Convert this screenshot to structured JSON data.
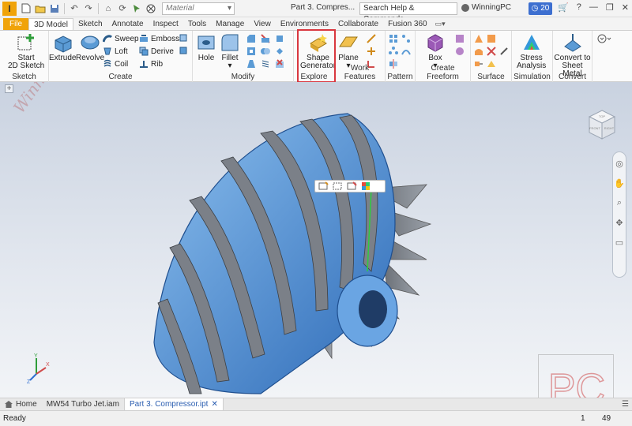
{
  "app": {
    "logo": "I"
  },
  "title_bar": {
    "material_placeholder": "Material",
    "document_title": "Part 3. Compres...",
    "help_search": "Search Help & Commands...",
    "user_name": "WinningPC",
    "clock_badge": "20"
  },
  "tabs": [
    "File",
    "3D Model",
    "Sketch",
    "Annotate",
    "Inspect",
    "Tools",
    "Manage",
    "View",
    "Environments",
    "Collaborate",
    "Fusion 360"
  ],
  "ribbon": {
    "sketch_panel": {
      "title": "Sketch",
      "start_label_1": "Start",
      "start_label_2": "2D Sketch"
    },
    "create_panel": {
      "title": "Create",
      "extrude": "Extrude",
      "revolve": "Revolve",
      "sweep": "Sweep",
      "loft": "Loft",
      "coil": "Coil",
      "emboss": "Emboss",
      "derive": "Derive",
      "rib": "Rib"
    },
    "modify_panel": {
      "title": "Modify",
      "hole": "Hole",
      "fillet": "Fillet"
    },
    "explore_panel": {
      "title": "Explore",
      "shape_1": "Shape",
      "shape_2": "Generator"
    },
    "work_features_panel": {
      "title": "Work Features",
      "plane": "Plane"
    },
    "pattern_panel": {
      "title": "Pattern"
    },
    "freeform_panel": {
      "title": "Create Freeform",
      "box": "Box"
    },
    "surface_panel": {
      "title": "Surface"
    },
    "simulation_panel": {
      "title": "Simulation",
      "stress_1": "Stress",
      "stress_2": "Analysis"
    },
    "convert_panel": {
      "title": "Convert",
      "convert_1": "Convert to",
      "convert_2": "Sheet Metal"
    }
  },
  "viewport": {
    "watermark_left": "WinningPC",
    "watermark_logo": "PC",
    "viewcube_top": "TOP",
    "viewcube_front": "FRONT",
    "viewcube_right": "RIGHT",
    "triad_x": "X",
    "triad_y": "Y",
    "triad_z": "Z"
  },
  "doc_tabs": {
    "home": "Home",
    "tab1": "MW54 Turbo Jet.iam",
    "tab2": "Part 3. Compressor.ipt"
  },
  "status": {
    "text": "Ready",
    "n1": "1",
    "n2": "49"
  },
  "colors": {
    "accent": "#f0a30a",
    "highlight": "#d9373f",
    "selection": "#3a7fd5"
  }
}
